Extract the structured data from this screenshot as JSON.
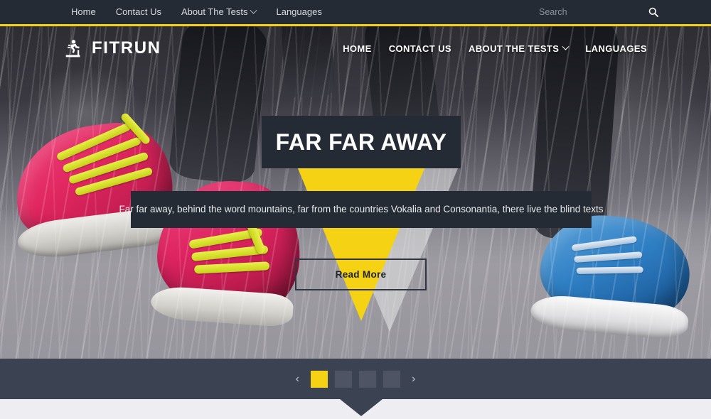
{
  "topbar": {
    "nav": [
      {
        "label": "Home",
        "has_caret": false
      },
      {
        "label": "Contact Us",
        "has_caret": false
      },
      {
        "label": "About The Tests",
        "has_caret": true
      },
      {
        "label": "Languages",
        "has_caret": false
      }
    ],
    "search": {
      "placeholder": "Search",
      "value": "",
      "icon": "search-icon"
    },
    "accent_color": "#f5d213",
    "background_color": "#252b35"
  },
  "header": {
    "logo": {
      "text": "FITRUN",
      "icon": "treadmill-runner-icon"
    },
    "nav": [
      {
        "label": "HOME",
        "has_caret": false
      },
      {
        "label": "CONTACT US",
        "has_caret": false
      },
      {
        "label": "ABOUT THE TESTS",
        "has_caret": true
      },
      {
        "label": "LANGUAGES",
        "has_caret": false
      }
    ]
  },
  "hero": {
    "title": "FAR FAR AWAY",
    "subtitle": "Far far away, behind the word mountains, far from the countries Vokalia and Consonantia, there live the blind texts",
    "cta_label": "Read More",
    "background_description": "Close-up photo of pink and blue running shoes on wet pavement in heavy rain",
    "panel_color": "#252b35",
    "triangle_color": "#f5d213"
  },
  "slider": {
    "prev_label": "‹",
    "next_label": "›",
    "slides": [
      {
        "index": 1,
        "active": true
      },
      {
        "index": 2,
        "active": false
      },
      {
        "index": 3,
        "active": false
      },
      {
        "index": 4,
        "active": false
      }
    ],
    "active_index": 1,
    "bar_color": "#3b4252",
    "active_dot_color": "#f5d213",
    "scroll_hint": "scroll-down-arrow"
  }
}
